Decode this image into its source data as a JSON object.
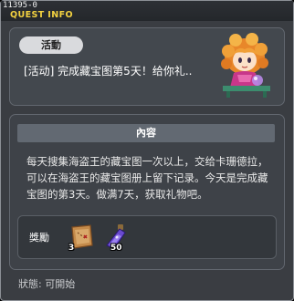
{
  "window": {
    "id_label": "11395-0",
    "title": "QUEST INFO"
  },
  "quest": {
    "category": "活動",
    "name": "[活动] 完成藏宝图第5天！给你礼.."
  },
  "content": {
    "header": "內容",
    "description": "每天搜集海盗王的藏宝图一次以上，交给卡珊德拉，可以在海盗王的藏宝图册上留下记录。今天是完成藏宝图的第3天。做满7天，获取礼物吧。",
    "reward_label": "獎勵",
    "rewards": [
      {
        "icon": "treasure-map-scroll-icon",
        "quantity": "3"
      },
      {
        "icon": "potion-flask-icon",
        "quantity": "50"
      }
    ]
  },
  "status": {
    "text": "狀態: 可開始"
  },
  "colors": {
    "title": "#f3d240",
    "panel_bg": "#43484e",
    "header_bg": "#626972"
  }
}
